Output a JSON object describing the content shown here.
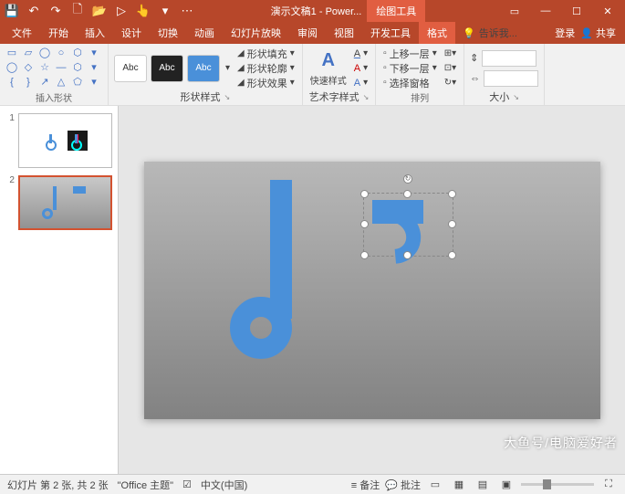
{
  "titlebar": {
    "doc_title": "演示文稿1 - Power...",
    "context_tool": "绘图工具"
  },
  "tabs": {
    "file": "文件",
    "home": "开始",
    "insert": "插入",
    "design": "设计",
    "transitions": "切换",
    "animations": "动画",
    "slideshow": "幻灯片放映",
    "review": "审阅",
    "view": "视图",
    "developer": "开发工具",
    "format": "格式",
    "tellme": "告诉我...",
    "signin": "登录",
    "share": "共享"
  },
  "ribbon": {
    "insert_shapes": "插入形状",
    "shape_styles": "形状样式",
    "wordart_styles": "艺术字样式",
    "arrange": "排列",
    "size": "大小",
    "abc": "Abc",
    "shape_fill": "形状填充",
    "shape_outline": "形状轮廓",
    "shape_effects": "形状效果",
    "quick_styles": "快速样式",
    "bring_forward": "上移一层",
    "send_backward": "下移一层",
    "selection_pane": "选择窗格"
  },
  "thumbs": [
    {
      "num": "1"
    },
    {
      "num": "2"
    }
  ],
  "status": {
    "slide_info": "幻灯片 第 2 张, 共 2 张",
    "theme": "\"Office 主题\"",
    "lang": "中文(中国)",
    "notes": "备注",
    "comments": "批注"
  },
  "watermark": "大鱼号/电脑爱好者"
}
